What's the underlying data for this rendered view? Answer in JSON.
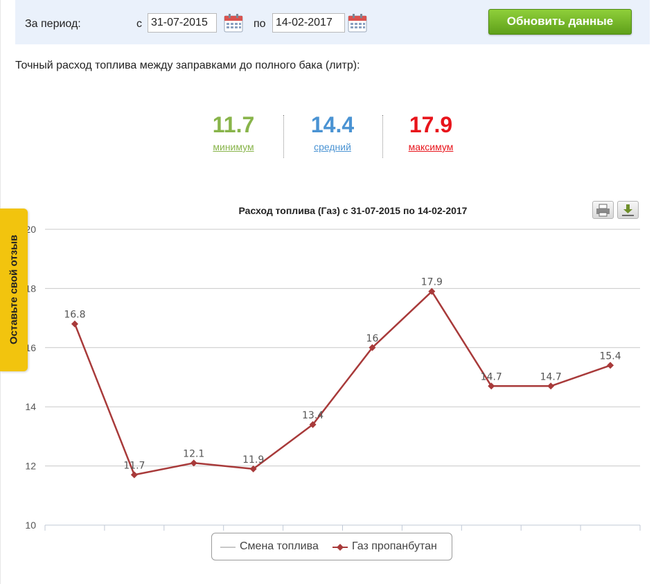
{
  "period": {
    "label": "За период:",
    "from_label": "с",
    "from_value": "31-07-2015",
    "to_label": "по",
    "to_value": "14-02-2017",
    "refresh_label": "Обновить данные"
  },
  "description": "Точный расход топлива между заправками до полного бака (литр):",
  "stats": {
    "min": {
      "value": "11.7",
      "label": "минимум",
      "color": "#88b44a"
    },
    "avg": {
      "value": "14.4",
      "label": "средний",
      "color": "#4a93d3"
    },
    "max": {
      "value": "17.9",
      "label": "максимум",
      "color": "#e8141b"
    }
  },
  "feedback_label": "Оставьте свой отзыв",
  "icons": {
    "calendar": "calendar-icon",
    "print": "print-icon",
    "download": "download-icon"
  },
  "chart_data": {
    "type": "line",
    "title": "Расход топлива (Газ) с 31-07-2015 по 14-02-2017",
    "xlabel": "",
    "ylabel": "",
    "ylim": [
      10,
      20
    ],
    "yticks": [
      10,
      12,
      14,
      16,
      18,
      20
    ],
    "grid": true,
    "legend_placement": "bottom-center",
    "x": [
      1,
      2,
      3,
      4,
      5,
      6,
      7,
      8,
      9,
      10
    ],
    "series": [
      {
        "name": "Смена топлива",
        "values": [],
        "color": "#c8c8c8"
      },
      {
        "name": "Газ пропанбутан",
        "values": [
          16.8,
          11.7,
          12.1,
          11.9,
          13.4,
          16,
          17.9,
          14.7,
          14.7,
          15.4
        ],
        "color": "#a83a3a"
      }
    ],
    "data_labels": [
      "16.8",
      "11.7",
      "12.1",
      "11.9",
      "13.4",
      "16",
      "17.9",
      "14.7",
      "14.7",
      "15.4"
    ]
  }
}
